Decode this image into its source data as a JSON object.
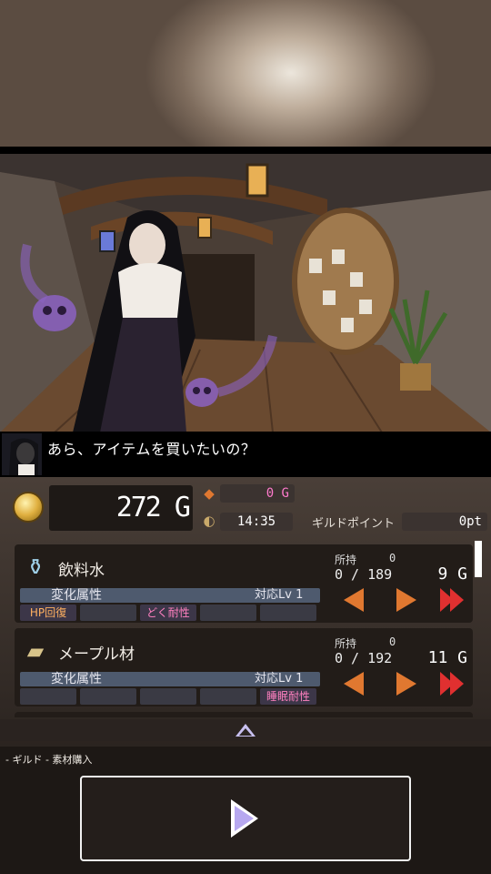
{
  "dialogue": {
    "text": "あら、アイテムを買いたいの？"
  },
  "status": {
    "gold": "272 G",
    "cost": "0 G",
    "time": "14:35",
    "guild_label": "ギルドポイント",
    "guild_points": "0pt"
  },
  "items": [
    {
      "name": "飲料水",
      "icon": "water-bottle-icon",
      "own_label": "所持",
      "own_value": "0",
      "count": "0 / 189",
      "price": "9 G",
      "attr_label": "変化属性",
      "lv": "対応Lv 1",
      "slots": [
        "HP回復",
        "",
        "どく耐性",
        "",
        ""
      ]
    },
    {
      "name": "メープル材",
      "icon": "wood-icon",
      "own_label": "所持",
      "own_value": "0",
      "count": "0 / 192",
      "price": "11 G",
      "attr_label": "変化属性",
      "lv": "対応Lv 1",
      "slots": [
        "",
        "",
        "",
        "",
        "睡眠耐性"
      ]
    }
  ],
  "breadcrumb": "- ギルド - 素材購入",
  "colors": {
    "accent_orange": "#e07830",
    "slot_blue": "#4e5a6e",
    "play": "#b7a8f0"
  }
}
